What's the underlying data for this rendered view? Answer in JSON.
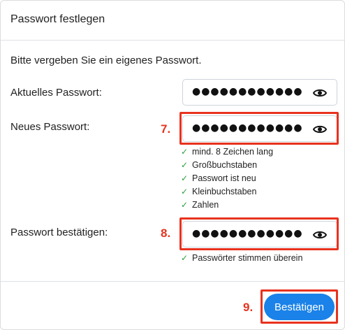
{
  "dialog": {
    "title": "Passwort festlegen",
    "intro": "Bitte vergeben Sie ein eigenes Passwort."
  },
  "fields": {
    "current": {
      "label": "Aktuelles Passwort:",
      "value": "●●●●●●●●●●●●●●●●",
      "toggle_icon": "eye-icon"
    },
    "new": {
      "label": "Neues Passwort:",
      "value": "●●●●●●●●●●●●",
      "toggle_icon": "eye-icon"
    },
    "confirm": {
      "label": "Passwort bestätigen:",
      "value": "●●●●●●●●●●●●",
      "toggle_icon": "eye-icon"
    }
  },
  "requirements": [
    {
      "icon": "check-icon",
      "text": "mind. 8 Zeichen lang"
    },
    {
      "icon": "check-icon",
      "text": "Großbuchstaben"
    },
    {
      "icon": "check-icon",
      "text": "Passwort ist neu"
    },
    {
      "icon": "check-icon",
      "text": "Kleinbuchstaben"
    },
    {
      "icon": "check-icon",
      "text": "Zahlen"
    }
  ],
  "match_message": {
    "icon": "check-icon",
    "text": "Passwörter stimmen überein"
  },
  "annotations": {
    "step_7": "7.",
    "step_8": "8.",
    "step_9": "9."
  },
  "footer": {
    "confirm_label": "Bestätigen"
  },
  "colors": {
    "accent": "#1a82e8",
    "highlight": "#e8321e",
    "success": "#2c9d3a"
  }
}
